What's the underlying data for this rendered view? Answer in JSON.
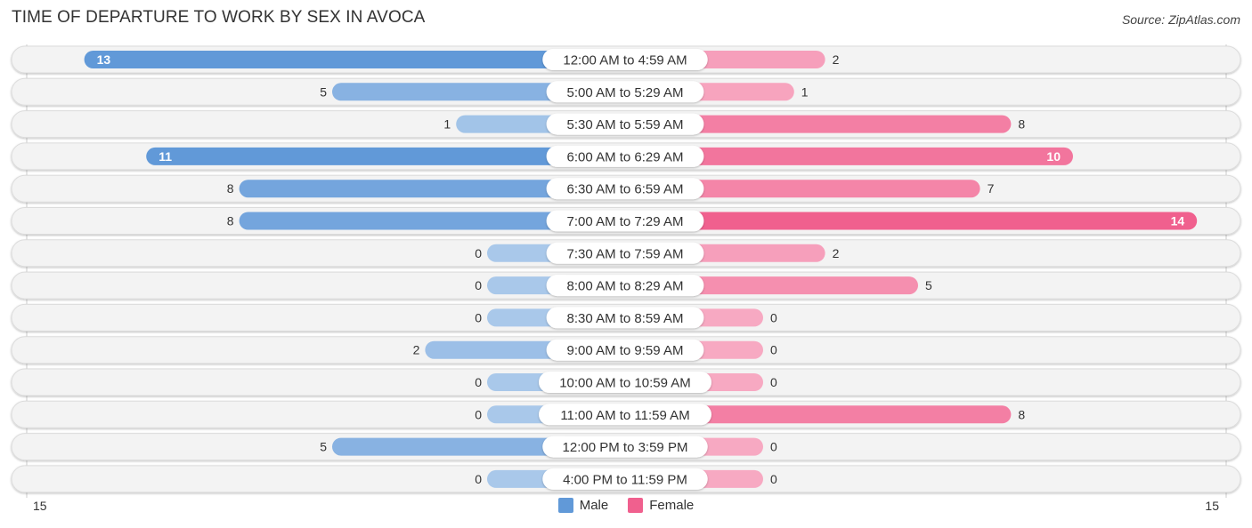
{
  "title": "TIME OF DEPARTURE TO WORK BY SEX IN AVOCA",
  "source": "Source: ZipAtlas.com",
  "colors": {
    "male_light": "#a9c8ea",
    "male_strong": "#6199d8",
    "female_light": "#f7a9c2",
    "female_strong": "#f0608e",
    "row_bg": "#f3f3f3"
  },
  "chart_data": {
    "type": "bar",
    "orientation": "horizontal-diverging",
    "title": "TIME OF DEPARTURE TO WORK BY SEX IN AVOCA",
    "categories": [
      "12:00 AM to 4:59 AM",
      "5:00 AM to 5:29 AM",
      "5:30 AM to 5:59 AM",
      "6:00 AM to 6:29 AM",
      "6:30 AM to 6:59 AM",
      "7:00 AM to 7:29 AM",
      "7:30 AM to 7:59 AM",
      "8:00 AM to 8:29 AM",
      "8:30 AM to 8:59 AM",
      "9:00 AM to 9:59 AM",
      "10:00 AM to 10:59 AM",
      "11:00 AM to 11:59 AM",
      "12:00 PM to 3:59 PM",
      "4:00 PM to 11:59 PM"
    ],
    "series": [
      {
        "name": "Male",
        "values": [
          13,
          5,
          1,
          11,
          8,
          8,
          0,
          0,
          0,
          2,
          0,
          0,
          5,
          0
        ]
      },
      {
        "name": "Female",
        "values": [
          2,
          1,
          8,
          10,
          7,
          14,
          2,
          5,
          0,
          0,
          0,
          8,
          0,
          0
        ]
      }
    ],
    "axis": {
      "left_label": "15",
      "right_label": "15",
      "xlim": [
        -15,
        15
      ]
    },
    "legend": {
      "position": "bottom-center",
      "entries": [
        "Male",
        "Female"
      ]
    }
  }
}
